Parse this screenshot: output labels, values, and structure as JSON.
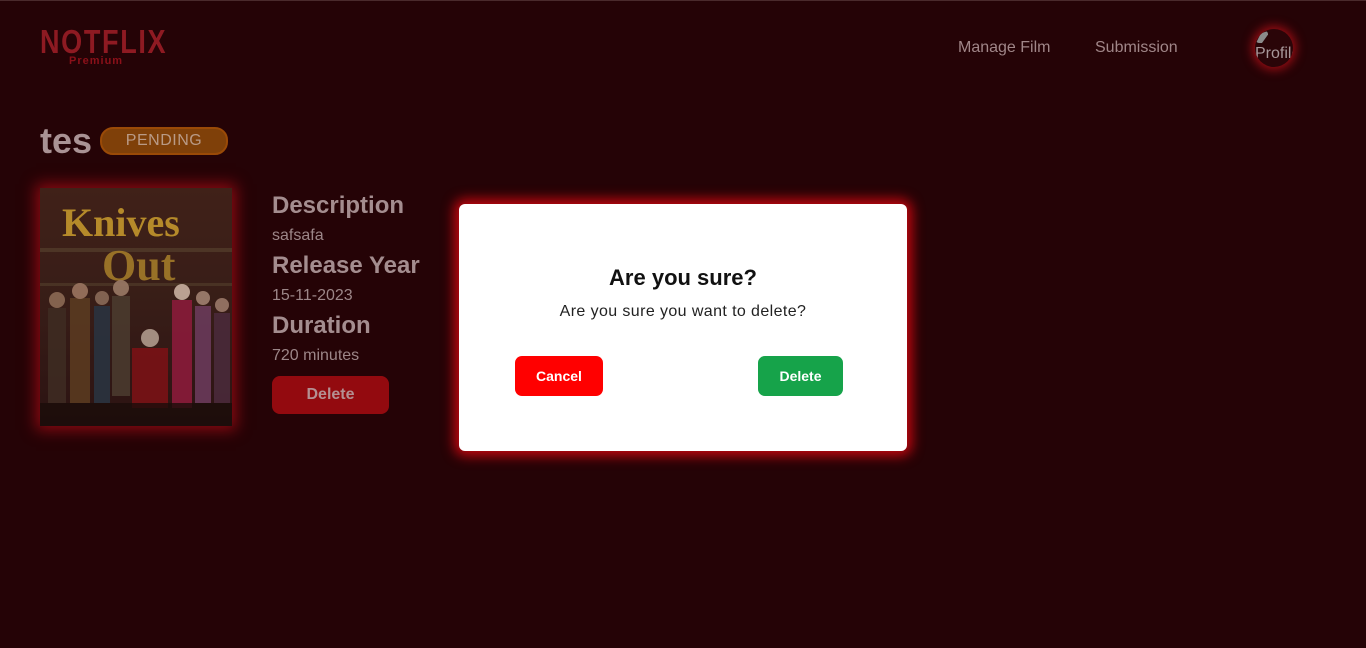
{
  "header": {
    "logo_text": "NOTFLIX",
    "logo_subtext": "Premium",
    "nav": [
      {
        "label": "Manage Film"
      },
      {
        "label": "Submission"
      }
    ],
    "profile_alt": "Profile"
  },
  "film": {
    "title": "tes",
    "status": "PENDING",
    "poster_icon": "movie-poster-knives-out",
    "description_label": "Description",
    "description": "safsafa",
    "release_year_label": "Release Year",
    "release_year": "15-11-2023",
    "duration_label": "Duration",
    "duration": "720 minutes",
    "delete_label": "Delete"
  },
  "modal": {
    "title": "Are you sure?",
    "message": "Are you sure you want to delete?",
    "cancel_label": "Cancel",
    "delete_label": "Delete"
  },
  "colors": {
    "background": "#250306",
    "accent_red": "#ff0000",
    "confirm_green": "#16a34a",
    "pending_orange": "#7f4009"
  }
}
